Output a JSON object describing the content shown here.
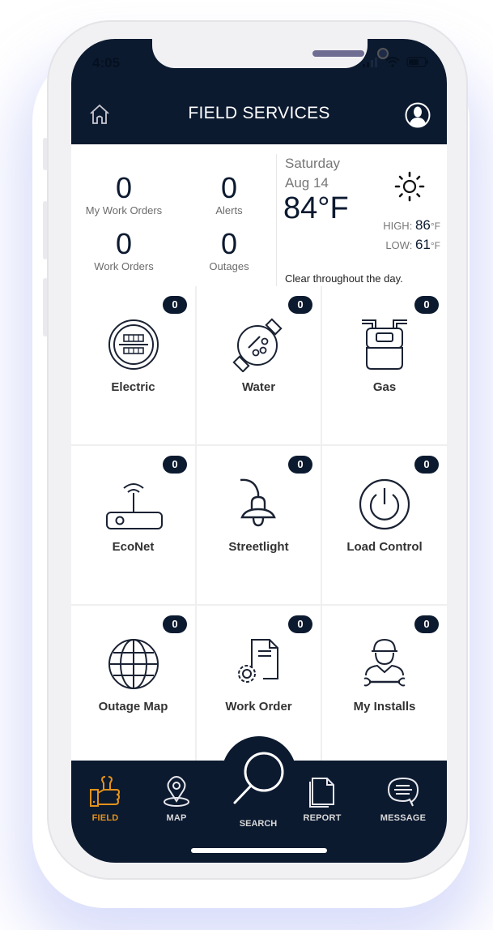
{
  "status_bar": {
    "time": "4:05"
  },
  "header": {
    "title": "FIELD SERVICES",
    "home_icon": "home-icon",
    "profile_icon": "profile-icon"
  },
  "summary": {
    "stats": [
      {
        "value": "0",
        "label": "My Work Orders"
      },
      {
        "value": "0",
        "label": "Alerts"
      },
      {
        "value": "0",
        "label": "Work Orders"
      },
      {
        "value": "0",
        "label": "Outages"
      }
    ]
  },
  "weather": {
    "day": "Saturday",
    "date": "Aug 14",
    "temperature": "84°F",
    "icon": "sun-icon",
    "high_label": "HIGH:",
    "high_value": "86",
    "low_label": "LOW:",
    "low_value": "61",
    "unit": "°F",
    "description": "Clear throughout the day."
  },
  "tiles": [
    {
      "label": "Electric",
      "badge": "0",
      "icon": "electric-meter-icon"
    },
    {
      "label": "Water",
      "badge": "0",
      "icon": "water-meter-icon"
    },
    {
      "label": "Gas",
      "badge": "0",
      "icon": "gas-meter-icon"
    },
    {
      "label": "EcoNet",
      "badge": "0",
      "icon": "router-icon"
    },
    {
      "label": "Streetlight",
      "badge": "0",
      "icon": "streetlight-icon"
    },
    {
      "label": "Load Control",
      "badge": "0",
      "icon": "power-icon"
    },
    {
      "label": "Outage Map",
      "badge": "0",
      "icon": "globe-icon"
    },
    {
      "label": "Work Order",
      "badge": "0",
      "icon": "work-order-icon"
    },
    {
      "label": "My Installs",
      "badge": "0",
      "icon": "installer-icon"
    }
  ],
  "nav": {
    "items": [
      {
        "label": "FIELD",
        "icon": "field-icon",
        "active": true
      },
      {
        "label": "MAP",
        "icon": "map-pin-icon",
        "active": false
      },
      {
        "label": "SEARCH",
        "icon": "search-icon",
        "active": false
      },
      {
        "label": "REPORT",
        "icon": "report-icon",
        "active": false
      },
      {
        "label": "MESSAGE",
        "icon": "message-icon",
        "active": false
      }
    ]
  },
  "colors": {
    "primary": "#0c1a30",
    "accent": "#e2921b",
    "background": "#ffffff"
  }
}
